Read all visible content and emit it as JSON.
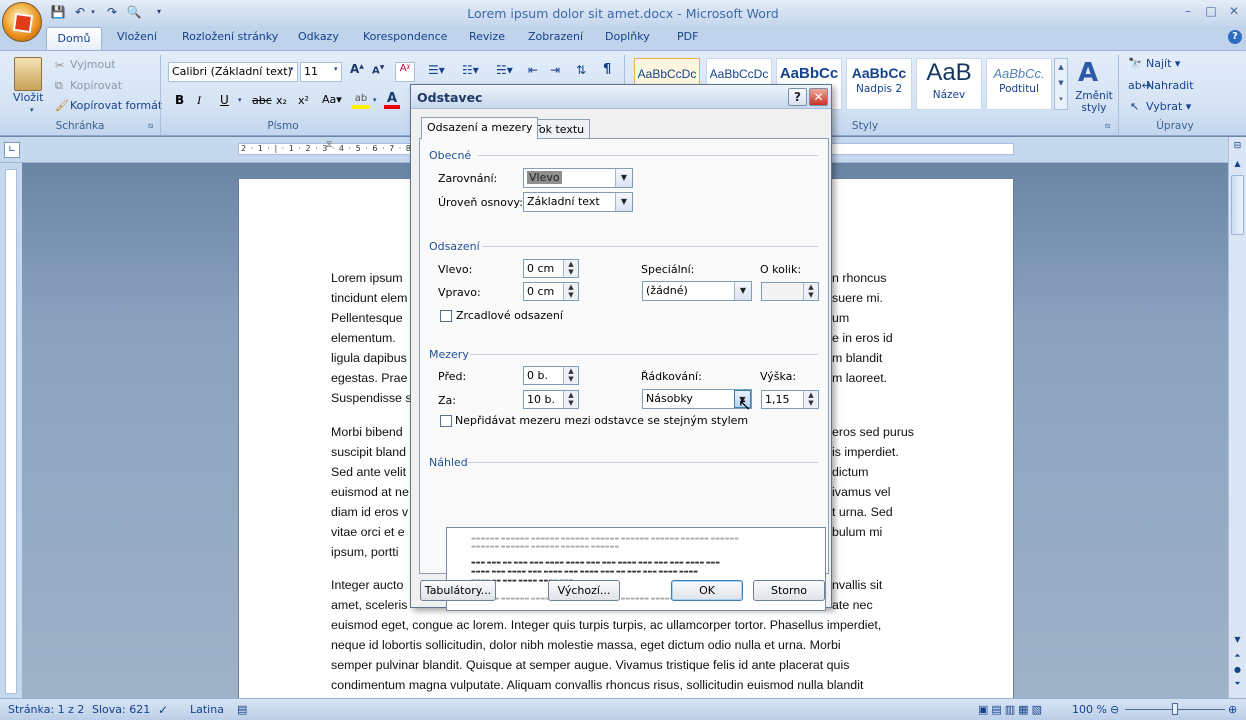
{
  "window": {
    "title": "Lorem ipsum dolor sit amet.docx - Microsoft Word",
    "minimize": "–",
    "maximize": "□",
    "close": "✕",
    "help": "?"
  },
  "ribbon_tabs": [
    "Domů",
    "Vložení",
    "Rozložení stránky",
    "Odkazy",
    "Korespondence",
    "Revize",
    "Zobrazení",
    "Doplňky",
    "PDF"
  ],
  "clipboard": {
    "paste": "Vložit",
    "cut": "Vyjmout",
    "copy": "Kopírovat",
    "format_painter": "Kopírovat formát",
    "group": "Schránka"
  },
  "font": {
    "name": "Calibri (Základní text)",
    "size": "11",
    "group": "Písmo"
  },
  "styles": {
    "tiles": [
      {
        "sample": "AaBbCcDc",
        "name": ""
      },
      {
        "sample": "AaBbCcDc",
        "name": ""
      },
      {
        "sample": "AaBbCc",
        "name": ""
      },
      {
        "sample": "AaBbCc",
        "name": "Nadpis 2"
      },
      {
        "sample": "AaB",
        "name": "Název"
      },
      {
        "sample": "AaBbCc.",
        "name": "Podtitul"
      }
    ],
    "change": "Změnit styly",
    "group": "Styly"
  },
  "editing": {
    "find": "Najít",
    "replace": "Nahradit",
    "select": "Vybrat",
    "group": "Úpravy"
  },
  "ruler_text": "2 · 1 · | · 1 · 2 · 3 · 4 · 5 · 6 · 7 · 8 · 9 · 10 · 11 · 12 · 13 · 14 · 15 · 16 · 17 · 18",
  "document": {
    "lines": [
      {
        "left": "Lorem ipsum",
        "right": "n rhoncus"
      },
      {
        "left": "tincidunt elem",
        "right": "suere mi."
      },
      {
        "left": "Pellentesque",
        "right": "um"
      },
      {
        "left": "elementum.",
        "right": "e in eros id"
      },
      {
        "left": "ligula dapibus",
        "right": "m blandit"
      },
      {
        "left": "egestas. Prae",
        "right": "m laoreet."
      },
      {
        "left": "Suspendisse s",
        "right": ""
      },
      {
        "left": "Morbi bibend",
        "right": "eros sed purus"
      },
      {
        "left": "suscipit bland",
        "right": "is imperdiet."
      },
      {
        "left": "Sed ante velit",
        "right": "dictum"
      },
      {
        "left": "euismod at ne",
        "right": "ivamus vel"
      },
      {
        "left": "diam id eros v",
        "right": "t urna. Sed"
      },
      {
        "left": "vitae orci et e",
        "right": "bulum mi"
      },
      {
        "left": "ipsum, portti",
        "right": ""
      },
      {
        "left": "Integer aucto",
        "right": "nvallis sit"
      },
      {
        "left": "amet, sceleris",
        "right": "ate nec"
      }
    ],
    "full_lines": [
      "euismod eget, congue ac lorem. Integer quis turpis turpis, ac ullamcorper tortor. Phasellus imperdiet,",
      "neque id lobortis sollicitudin, dolor nibh molestie massa, eget dictum odio nulla et urna. Morbi",
      "semper pulvinar blandit. Quisque at semper augue. Vivamus tristique felis id ante placerat quis",
      "condimentum magna vulputate. Aliquam convallis rhoncus risus, sollicitudin euismod nulla blandit"
    ]
  },
  "dialog": {
    "title": "Odstavec",
    "tabs": [
      "Odsazení a mezery",
      "Tok textu"
    ],
    "general": {
      "section": "Obecné",
      "alignment_label": "Zarovnání:",
      "alignment_value": "Vlevo",
      "outline_label": "Úroveň osnovy:",
      "outline_value": "Základní text"
    },
    "indent": {
      "section": "Odsazení",
      "left_label": "Vlevo:",
      "left_value": "0 cm",
      "right_label": "Vpravo:",
      "right_value": "0 cm",
      "special_label": "Speciální:",
      "special_value": "(žádné)",
      "by_label": "O kolik:",
      "by_value": "",
      "mirror_label": "Zrcadlové odsazení"
    },
    "spacing": {
      "section": "Mezery",
      "before_label": "Před:",
      "before_value": "0 b.",
      "after_label": "Za:",
      "after_value": "10 b.",
      "line_label": "Řádkování:",
      "line_value": "Násobky",
      "at_label": "Výška:",
      "at_value": "1,15",
      "no_space_label": "Nepřidávat mezeru mezi odstavce se stejným stylem"
    },
    "preview": {
      "section": "Náhled"
    },
    "buttons": {
      "tabs": "Tabulátory...",
      "default": "Výchozí...",
      "ok": "OK",
      "cancel": "Storno"
    }
  },
  "status": {
    "page": "Stránka: 1 z 2",
    "words": "Slova: 621",
    "language": "Latina",
    "zoom": "100 %"
  }
}
